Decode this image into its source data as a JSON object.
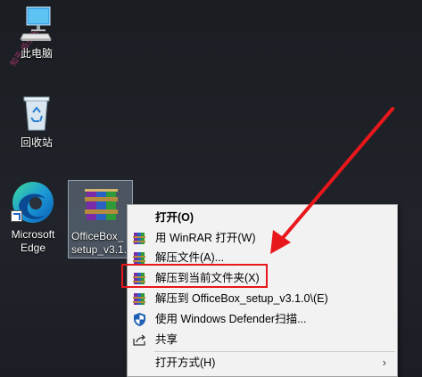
{
  "desktop": {
    "icons": [
      {
        "label": "此电脑"
      },
      {
        "label": "回收站"
      },
      {
        "label_line1": "Microsoft",
        "label_line2": "Edge"
      },
      {
        "label_line1": "OfficeBox_",
        "label_line2": "setup_v3.1.0"
      }
    ],
    "watermark_text": "知乎·佰乐乐"
  },
  "context_menu": {
    "items": [
      {
        "label": "打开(O)",
        "icon": "none",
        "bold": true
      },
      {
        "label": "用 WinRAR 打开(W)",
        "icon": "winrar-icon"
      },
      {
        "label": "解压文件(A)...",
        "icon": "winrar-icon"
      },
      {
        "label": "解压到当前文件夹(X)",
        "icon": "winrar-icon",
        "highlighted": true
      },
      {
        "label": "解压到 OfficeBox_setup_v3.1.0\\(E)",
        "icon": "winrar-icon"
      },
      {
        "label": "使用 Windows Defender扫描...",
        "icon": "defender-shield-icon"
      },
      {
        "label": "共享",
        "icon": "share-icon"
      },
      {
        "label": "打开方式(H)",
        "icon": "none",
        "has_submenu": true
      }
    ]
  },
  "annotation": {
    "highlight_color": "#e8171b",
    "arrow_color": "#e8171b"
  }
}
